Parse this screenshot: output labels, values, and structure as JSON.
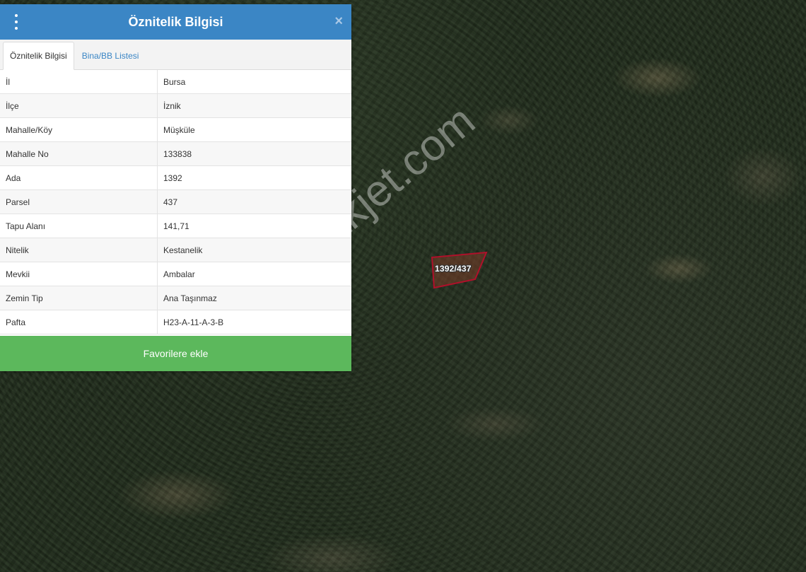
{
  "panel": {
    "title": "Öznitelik Bilgisi",
    "menu_icon": "vertical-dots-icon",
    "close_icon": "×",
    "tabs": [
      {
        "label": "Öznitelik Bilgisi",
        "active": true
      },
      {
        "label": "Bina/BB Listesi",
        "active": false
      }
    ],
    "rows": [
      {
        "key": "İl",
        "value": "Bursa"
      },
      {
        "key": "İlçe",
        "value": "İznik"
      },
      {
        "key": "Mahalle/Köy",
        "value": "Müşküle"
      },
      {
        "key": "Mahalle No",
        "value": "133838"
      },
      {
        "key": "Ada",
        "value": "1392"
      },
      {
        "key": "Parsel",
        "value": "437"
      },
      {
        "key": "Tapu Alanı",
        "value": "141,71"
      },
      {
        "key": "Nitelik",
        "value": "Kestanelik"
      },
      {
        "key": "Mevkii",
        "value": "Ambalar"
      },
      {
        "key": "Zemin Tip",
        "value": "Ana Taşınmaz"
      },
      {
        "key": "Pafta",
        "value": "H23-A-11-A-3-B"
      }
    ],
    "favorite_button": "Favorilere ekle"
  },
  "map": {
    "parcel_label": "1392/437",
    "watermark": "emlakjet.com",
    "parcel_stroke_color": "#b0102a"
  },
  "colors": {
    "header": "#3b86c5",
    "button": "#5cb85c"
  }
}
